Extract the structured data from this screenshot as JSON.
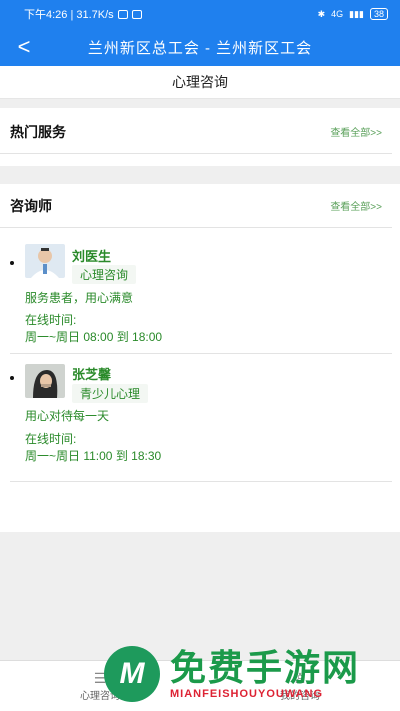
{
  "status_bar": {
    "time_net": "下午4:26 | 31.7K/s",
    "signal": "4G",
    "battery": "38"
  },
  "nav": {
    "back_glyph": "<",
    "title": "兰州新区总工会 - 兰州新区工会"
  },
  "tab_strip": {
    "label": "心理咨询"
  },
  "hot_services": {
    "title": "热门服务",
    "see_all": "查看全部>>"
  },
  "counselors": {
    "title": "咨询师",
    "see_all": "查看全部>>",
    "items": [
      {
        "name": "刘医生",
        "tag": "心理咨询",
        "motto": "服务患者，用心满意",
        "online_label": "在线时间:",
        "online_time": "周一~周日 08:00 到 18:00"
      },
      {
        "name": "张芝馨",
        "tag": "青少儿心理",
        "motto": "用心对待每一天",
        "online_label": "在线时间:",
        "online_time": "周一~周日 11:00 到 18:30"
      }
    ]
  },
  "tab_bar": {
    "items": [
      {
        "label": "心理咨询",
        "icon": "list-icon"
      },
      {
        "label": "我的咨询",
        "icon": "user-icon"
      }
    ]
  },
  "watermark": {
    "cn": "免费手游网",
    "en": "MIANFEISHOUYOUWANG"
  },
  "colors": {
    "brand_blue": "#1f80ee",
    "green_text": "#2a8a2a",
    "link_green": "#5aa05a"
  }
}
